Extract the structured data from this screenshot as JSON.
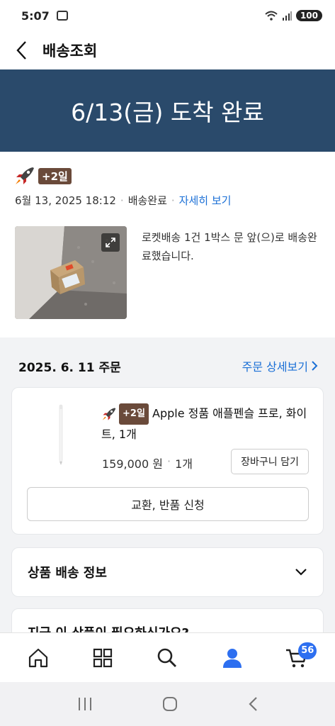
{
  "status": {
    "time": "5:07",
    "battery": "100"
  },
  "header": {
    "title": "배송조회"
  },
  "hero": {
    "text": "6/13(금) 도착 완료"
  },
  "delivery": {
    "badge": "+2일",
    "datetime": "6월 13, 2025 18:12",
    "status": "배송완료",
    "detail_link": "자세히 보기",
    "message": "로켓배송 1건 1박스 문 앞(으)로 배송완료했습니다."
  },
  "order": {
    "date": "2025. 6. 11 주문",
    "detail_link": "주문 상세보기"
  },
  "product": {
    "badge": "+2일",
    "title": "Apple 정품 애플펜슬 프로, 화이트, 1개",
    "price": "159,000 원",
    "quantity": "1개",
    "cart_button": "장바구니 담기",
    "return_button": "교환, 반품 신청"
  },
  "shipping_info": {
    "title": "상품 배송 정보"
  },
  "recommend": {
    "title": "지금 이 상품이 필요하신가요?"
  },
  "bottom_nav": {
    "cart_count": "56"
  },
  "colors": {
    "hero_bg": "#2a4a6b",
    "link": "#1a6fd6",
    "badge": "#6a4a3a",
    "cart_badge": "#2d6ff0"
  }
}
